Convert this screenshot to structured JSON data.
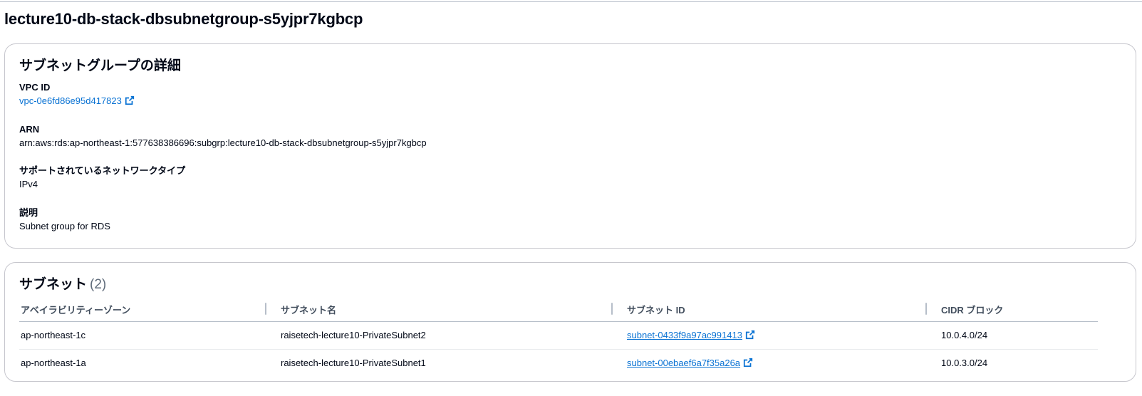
{
  "page": {
    "title": "lecture10-db-stack-dbsubnetgroup-s5yjpr7kgbcp"
  },
  "details": {
    "heading": "サブネットグループの詳細",
    "vpc_id": {
      "label": "VPC ID",
      "value": "vpc-0e6fd86e95d417823"
    },
    "arn": {
      "label": "ARN",
      "value": "arn:aws:rds:ap-northeast-1:577638386696:subgrp:lecture10-db-stack-dbsubnetgroup-s5yjpr7kgbcp"
    },
    "network_type": {
      "label": "サポートされているネットワークタイプ",
      "value": "IPv4"
    },
    "description": {
      "label": "説明",
      "value": "Subnet group for RDS"
    }
  },
  "subnets": {
    "heading": "サブネット",
    "count": "(2)",
    "columns": [
      "アベイラビリティーゾーン",
      "サブネット名",
      "サブネット ID",
      "CIDR ブロック"
    ],
    "rows": [
      {
        "az": "ap-northeast-1c",
        "name": "raisetech-lecture10-PrivateSubnet2",
        "subnet_id": "subnet-0433f9a97ac991413",
        "cidr": "10.0.4.0/24"
      },
      {
        "az": "ap-northeast-1a",
        "name": "raisetech-lecture10-PrivateSubnet1",
        "subnet_id": "subnet-00ebaef6a7f35a26a",
        "cidr": "10.0.3.0/24"
      }
    ]
  },
  "colors": {
    "link": "#0972d3",
    "text": "#000716",
    "border": "#c6c6cd"
  },
  "icons": {
    "external_link": "external-link-icon"
  }
}
